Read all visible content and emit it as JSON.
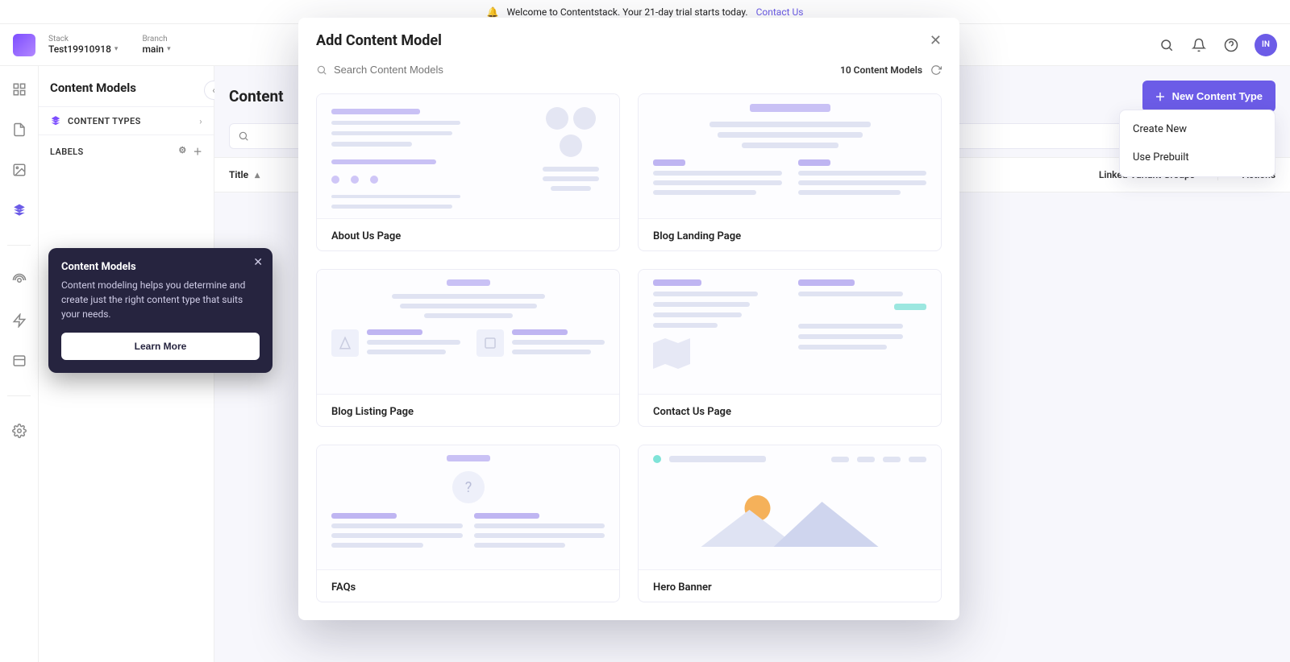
{
  "banner": {
    "text": "Welcome to Contentstack. Your 21-day trial starts today.",
    "contact": "Contact Us"
  },
  "header": {
    "stack_label": "Stack",
    "stack_value": "Test19910918",
    "branch_label": "Branch",
    "branch_value": "main",
    "avatar_initials": "IN"
  },
  "sidebar": {
    "title": "Content Models",
    "content_types": "CONTENT TYPES",
    "labels": "LABELS"
  },
  "page": {
    "title": "Content",
    "new_button": "New Content Type",
    "menu_create": "Create New",
    "menu_prebuilt": "Use Prebuilt",
    "col_title": "Title",
    "col_linked": "Linked Variant Groups",
    "col_actions": "Actions"
  },
  "tip": {
    "title": "Content Models",
    "body": "Content modeling helps you determine and create just the right content type that suits your needs.",
    "button": "Learn More"
  },
  "modal": {
    "title": "Add Content Model",
    "search_placeholder": "Search Content Models",
    "count": "10 Content Models",
    "cards": {
      "about": "About Us Page",
      "blog_landing": "Blog Landing Page",
      "blog_listing": "Blog Listing Page",
      "contact": "Contact Us Page",
      "faqs": "FAQs",
      "hero": "Hero Banner"
    }
  }
}
